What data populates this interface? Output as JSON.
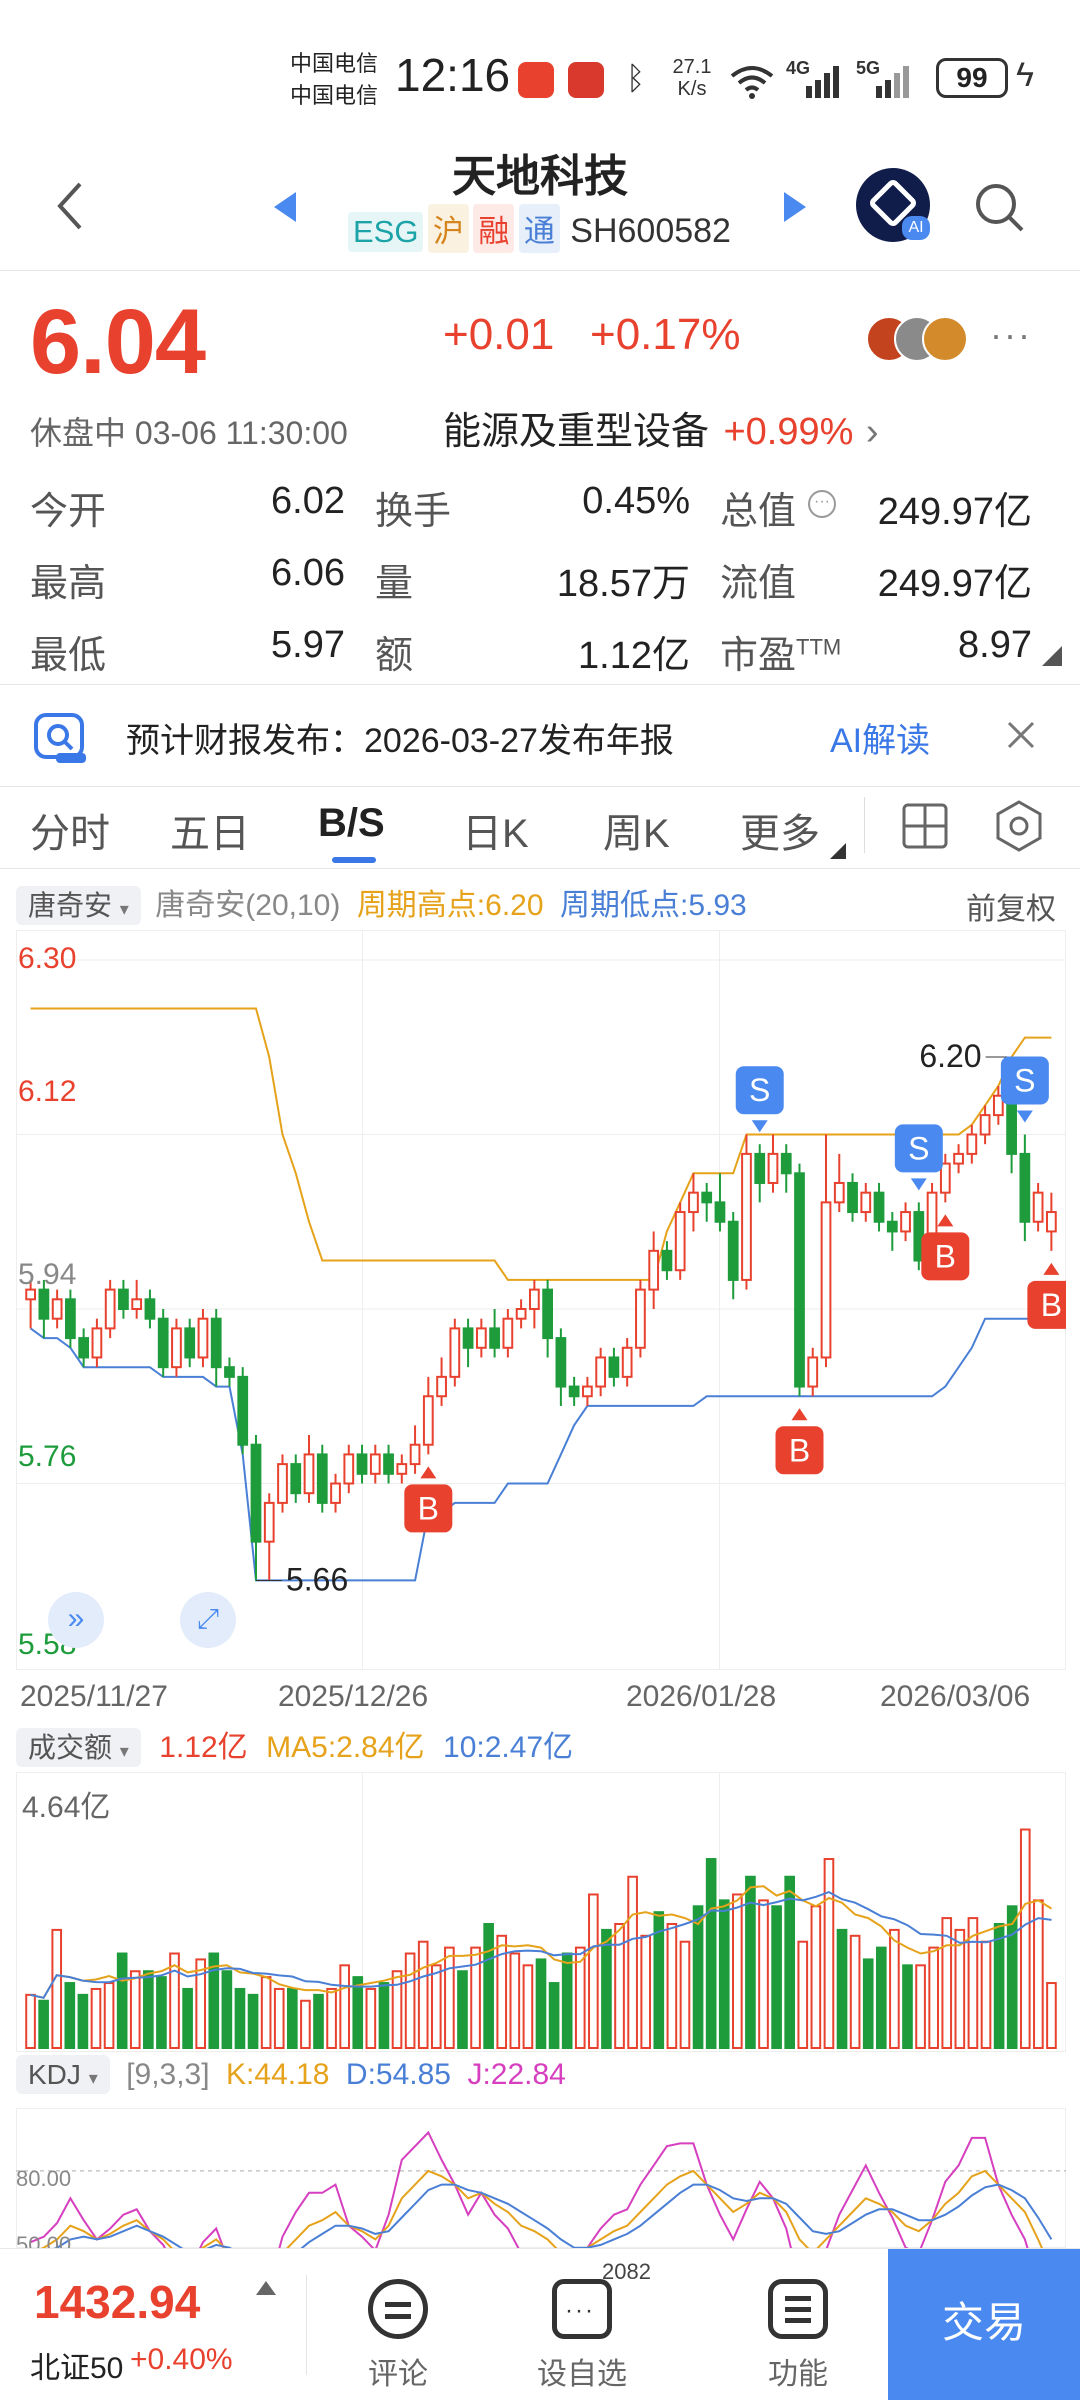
{
  "status_bar": {
    "carrier1": "中国电信",
    "carrier2": "中国电信",
    "time": "12:16",
    "net_speed_value": "27.1",
    "net_speed_unit": "K/s",
    "net1": "4G",
    "net2": "5G",
    "battery": "99"
  },
  "header": {
    "title": "天地科技",
    "tags": [
      "ESG",
      "沪",
      "融",
      "通"
    ],
    "code": "SH600582"
  },
  "quote": {
    "price": "6.04",
    "change": "+0.01",
    "change_pct": "+0.17%",
    "session_status": "休盘中 03-06 11:30:00",
    "sector": "能源及重型设备",
    "sector_change": "+0.99%"
  },
  "stats": {
    "open_label": "今开",
    "open": "6.02",
    "high_label": "最高",
    "high": "6.06",
    "low_label": "最低",
    "low": "5.97",
    "turnover_label": "换手",
    "turnover": "0.45%",
    "volume_label": "量",
    "volume": "18.57万",
    "amount_label": "额",
    "amount": "1.12亿",
    "mktcap_label": "总值",
    "mktcap": "249.97亿",
    "float_label": "流值",
    "float": "249.97亿",
    "pe_label": "市盈",
    "pe_sup": "TTM",
    "pe": "8.97"
  },
  "notice": {
    "text": "预计财报发布：2026-03-27发布年报",
    "ai_label": "AI解读"
  },
  "tabs": [
    "分时",
    "五日",
    "B/S",
    "日K",
    "周K",
    "更多"
  ],
  "active_tab": "B/S",
  "chart_header": {
    "indicator": "唐奇安",
    "params": "唐奇安(20,10)",
    "period_high": "周期高点:6.20",
    "period_low": "周期低点:5.93",
    "adjust": "前复权"
  },
  "price_axis": [
    "6.30",
    "6.12",
    "5.94",
    "5.76",
    "5.58"
  ],
  "date_axis": [
    "2025/11/27",
    "2025/12/26",
    "2026/01/28",
    "2026/03/06"
  ],
  "annotations": {
    "max_label": "6.20",
    "min_label": "5.66",
    "buy": "B",
    "sell": "S"
  },
  "volume_header": {
    "indicator": "成交额",
    "current": "1.12亿",
    "ma5": "MA5:2.84亿",
    "ma10": "10:2.47亿",
    "max_label": "4.64亿"
  },
  "kdj_header": {
    "indicator": "KDJ",
    "params": "[9,3,3]",
    "k": "K:44.18",
    "d": "D:54.85",
    "j": "J:22.84",
    "level_80": "80.00",
    "level_50": "50.00"
  },
  "bottom": {
    "index_value": "1432.94",
    "index_name": "北证50",
    "index_change": "+0.40%",
    "comment": "评论",
    "watch": "设自选",
    "watch_count": "2082",
    "function": "功能",
    "trade": "交易"
  },
  "colors": {
    "up": "#e8412e",
    "down": "#1e9c3c",
    "upper_band": "#e5a21a",
    "lower_band": "#4a7fd6",
    "trade_button": "#4a8af0"
  },
  "chart_data": {
    "type": "candlestick",
    "title": "唐奇安(20,10)",
    "y_range": [
      5.58,
      6.3
    ],
    "x_ticks": [
      "2025/11/27",
      "2025/12/26",
      "2026/01/28",
      "2026/03/06"
    ],
    "candles": [
      [
        5.95,
        5.96,
        5.92,
        5.97
      ],
      [
        5.96,
        5.93,
        5.91,
        5.97
      ],
      [
        5.93,
        5.95,
        5.92,
        5.96
      ],
      [
        5.95,
        5.91,
        5.9,
        5.96
      ],
      [
        5.91,
        5.89,
        5.88,
        5.92
      ],
      [
        5.89,
        5.92,
        5.88,
        5.93
      ],
      [
        5.92,
        5.96,
        5.91,
        5.97
      ],
      [
        5.96,
        5.94,
        5.93,
        5.97
      ],
      [
        5.94,
        5.95,
        5.93,
        5.97
      ],
      [
        5.95,
        5.93,
        5.92,
        5.96
      ],
      [
        5.93,
        5.88,
        5.87,
        5.94
      ],
      [
        5.88,
        5.92,
        5.87,
        5.93
      ],
      [
        5.92,
        5.89,
        5.88,
        5.93
      ],
      [
        5.89,
        5.93,
        5.88,
        5.94
      ],
      [
        5.93,
        5.88,
        5.86,
        5.94
      ],
      [
        5.88,
        5.87,
        5.86,
        5.89
      ],
      [
        5.87,
        5.8,
        5.79,
        5.88
      ],
      [
        5.8,
        5.7,
        5.66,
        5.81
      ],
      [
        5.7,
        5.74,
        5.66,
        5.75
      ],
      [
        5.74,
        5.78,
        5.73,
        5.79
      ],
      [
        5.78,
        5.75,
        5.74,
        5.79
      ],
      [
        5.75,
        5.79,
        5.74,
        5.81
      ],
      [
        5.79,
        5.74,
        5.73,
        5.8
      ],
      [
        5.74,
        5.76,
        5.73,
        5.77
      ],
      [
        5.76,
        5.79,
        5.75,
        5.8
      ],
      [
        5.79,
        5.77,
        5.76,
        5.8
      ],
      [
        5.77,
        5.79,
        5.76,
        5.8
      ],
      [
        5.79,
        5.77,
        5.76,
        5.8
      ],
      [
        5.77,
        5.78,
        5.76,
        5.79
      ],
      [
        5.78,
        5.8,
        5.77,
        5.82
      ],
      [
        5.8,
        5.85,
        5.79,
        5.87
      ],
      [
        5.85,
        5.87,
        5.84,
        5.89
      ],
      [
        5.87,
        5.92,
        5.86,
        5.93
      ],
      [
        5.92,
        5.9,
        5.88,
        5.93
      ],
      [
        5.9,
        5.92,
        5.89,
        5.93
      ],
      [
        5.92,
        5.9,
        5.89,
        5.94
      ],
      [
        5.9,
        5.93,
        5.89,
        5.94
      ],
      [
        5.93,
        5.94,
        5.92,
        5.95
      ],
      [
        5.94,
        5.96,
        5.92,
        5.97
      ],
      [
        5.96,
        5.91,
        5.89,
        5.97
      ],
      [
        5.91,
        5.86,
        5.84,
        5.92
      ],
      [
        5.86,
        5.85,
        5.84,
        5.87
      ],
      [
        5.85,
        5.86,
        5.84,
        5.87
      ],
      [
        5.86,
        5.89,
        5.85,
        5.9
      ],
      [
        5.89,
        5.87,
        5.86,
        5.9
      ],
      [
        5.87,
        5.9,
        5.86,
        5.91
      ],
      [
        5.9,
        5.96,
        5.89,
        5.97
      ],
      [
        5.96,
        6.0,
        5.94,
        6.02
      ],
      [
        6.0,
        5.98,
        5.97,
        6.01
      ],
      [
        5.98,
        6.04,
        5.97,
        6.05
      ],
      [
        6.04,
        6.06,
        6.02,
        6.08
      ],
      [
        6.06,
        6.05,
        6.03,
        6.07
      ],
      [
        6.05,
        6.03,
        6.02,
        6.08
      ],
      [
        6.03,
        5.97,
        5.95,
        6.04
      ],
      [
        5.97,
        6.1,
        5.96,
        6.12
      ],
      [
        6.1,
        6.07,
        6.05,
        6.11
      ],
      [
        6.07,
        6.1,
        6.06,
        6.12
      ],
      [
        6.1,
        6.08,
        6.06,
        6.11
      ],
      [
        6.08,
        5.86,
        5.85,
        6.09
      ],
      [
        5.86,
        5.89,
        5.85,
        5.9
      ],
      [
        5.89,
        6.05,
        5.88,
        6.12
      ],
      [
        6.05,
        6.07,
        6.04,
        6.1
      ],
      [
        6.07,
        6.04,
        6.03,
        6.08
      ],
      [
        6.04,
        6.06,
        6.03,
        6.07
      ],
      [
        6.06,
        6.03,
        6.02,
        6.07
      ],
      [
        6.03,
        6.02,
        6.0,
        6.04
      ],
      [
        6.02,
        6.04,
        6.01,
        6.05
      ],
      [
        6.04,
        5.99,
        5.98,
        6.05
      ],
      [
        5.99,
        6.06,
        5.98,
        6.07
      ],
      [
        6.06,
        6.09,
        6.05,
        6.1
      ],
      [
        6.09,
        6.1,
        6.08,
        6.11
      ],
      [
        6.1,
        6.12,
        6.09,
        6.13
      ],
      [
        6.12,
        6.14,
        6.11,
        6.15
      ],
      [
        6.14,
        6.16,
        6.13,
        6.17
      ],
      [
        6.16,
        6.1,
        6.08,
        6.2
      ],
      [
        6.1,
        6.03,
        6.01,
        6.12
      ],
      [
        6.03,
        6.06,
        6.02,
        6.07
      ],
      [
        6.02,
        6.04,
        6.0,
        6.06
      ]
    ],
    "donchian_upper": [
      6.25,
      6.25,
      6.25,
      6.25,
      6.25,
      6.25,
      6.25,
      6.25,
      6.25,
      6.25,
      6.25,
      6.25,
      6.25,
      6.25,
      6.25,
      6.25,
      6.25,
      6.25,
      6.2,
      6.12,
      6.08,
      6.03,
      5.99,
      5.99,
      5.99,
      5.99,
      5.99,
      5.99,
      5.99,
      5.99,
      5.99,
      5.99,
      5.99,
      5.99,
      5.99,
      5.99,
      5.97,
      5.97,
      5.97,
      5.97,
      5.97,
      5.97,
      5.97,
      5.97,
      5.97,
      5.97,
      5.97,
      5.97,
      6.02,
      6.05,
      6.08,
      6.08,
      6.08,
      6.08,
      6.12,
      6.12,
      6.12,
      6.12,
      6.12,
      6.12,
      6.12,
      6.12,
      6.12,
      6.12,
      6.12,
      6.12,
      6.12,
      6.12,
      6.12,
      6.12,
      6.12,
      6.13,
      6.15,
      6.17,
      6.2,
      6.22,
      6.22,
      6.22
    ],
    "donchian_lower": [
      5.92,
      5.91,
      5.91,
      5.9,
      5.88,
      5.88,
      5.88,
      5.88,
      5.88,
      5.88,
      5.87,
      5.87,
      5.87,
      5.87,
      5.86,
      5.86,
      5.79,
      5.66,
      5.66,
      5.66,
      5.66,
      5.66,
      5.66,
      5.66,
      5.66,
      5.66,
      5.66,
      5.66,
      5.66,
      5.66,
      5.73,
      5.73,
      5.74,
      5.74,
      5.74,
      5.74,
      5.76,
      5.76,
      5.76,
      5.76,
      5.79,
      5.82,
      5.84,
      5.84,
      5.84,
      5.84,
      5.84,
      5.84,
      5.84,
      5.84,
      5.84,
      5.85,
      5.85,
      5.85,
      5.85,
      5.85,
      5.85,
      5.85,
      5.85,
      5.85,
      5.85,
      5.85,
      5.85,
      5.85,
      5.85,
      5.85,
      5.85,
      5.85,
      5.85,
      5.86,
      5.88,
      5.9,
      5.93,
      5.93,
      5.93,
      5.93,
      5.93,
      5.93
    ],
    "buy_signal_indices": [
      30,
      58,
      69,
      77
    ],
    "sell_signal_indices": [
      55,
      67,
      75
    ],
    "volume_range": [
      0,
      4.64
    ],
    "volume": [
      0.9,
      0.8,
      2.0,
      1.1,
      0.9,
      1.0,
      1.1,
      1.6,
      1.3,
      1.3,
      1.2,
      1.6,
      1.0,
      1.5,
      1.6,
      1.3,
      1.0,
      0.9,
      1.2,
      1.0,
      1.0,
      0.8,
      0.9,
      1.0,
      1.4,
      1.2,
      1.0,
      1.1,
      1.3,
      1.6,
      1.8,
      1.4,
      1.7,
      1.3,
      1.7,
      2.1,
      1.9,
      1.6,
      1.4,
      1.5,
      1.1,
      1.6,
      1.7,
      2.6,
      2.0,
      2.1,
      2.9,
      1.9,
      2.3,
      2.1,
      1.8,
      2.4,
      3.2,
      2.5,
      2.6,
      2.9,
      2.5,
      2.4,
      2.9,
      1.8,
      2.4,
      3.2,
      2.0,
      1.9,
      1.5,
      1.7,
      2.0,
      1.4,
      1.4,
      1.7,
      2.2,
      2.0,
      2.2,
      1.8,
      2.1,
      2.4,
      3.7,
      2.5,
      1.1
    ],
    "kdj_K": [
      50,
      52,
      55,
      60,
      58,
      55,
      57,
      60,
      62,
      58,
      55,
      50,
      48,
      52,
      55,
      50,
      45,
      40,
      42,
      50,
      55,
      60,
      62,
      65,
      60,
      58,
      55,
      60,
      70,
      75,
      80,
      78,
      75,
      70,
      72,
      68,
      65,
      60,
      58,
      55,
      50,
      48,
      52,
      55,
      58,
      60,
      65,
      70,
      75,
      78,
      80,
      75,
      70,
      65,
      68,
      72,
      70,
      65,
      55,
      50,
      55,
      60,
      65,
      70,
      68,
      65,
      60,
      58,
      62,
      68,
      72,
      78,
      80,
      75,
      70,
      65,
      55,
      44
    ],
    "kdj_D": [
      48,
      50,
      52,
      55,
      56,
      55,
      56,
      58,
      60,
      58,
      56,
      53,
      50,
      51,
      53,
      52,
      49,
      45,
      44,
      47,
      50,
      54,
      57,
      60,
      60,
      59,
      57,
      58,
      63,
      68,
      73,
      75,
      75,
      73,
      72,
      70,
      68,
      65,
      62,
      59,
      55,
      52,
      52,
      53,
      55,
      57,
      60,
      64,
      68,
      72,
      75,
      75,
      73,
      70,
      69,
      70,
      70,
      68,
      63,
      58,
      57,
      58,
      61,
      64,
      66,
      66,
      64,
      62,
      62,
      64,
      67,
      71,
      74,
      75,
      73,
      70,
      63,
      55
    ],
    "kdj_J": [
      54,
      56,
      61,
      70,
      62,
      55,
      59,
      64,
      66,
      58,
      53,
      44,
      44,
      54,
      59,
      46,
      37,
      30,
      38,
      56,
      65,
      72,
      72,
      75,
      60,
      56,
      51,
      64,
      84,
      89,
      94,
      84,
      75,
      64,
      72,
      64,
      59,
      50,
      50,
      47,
      40,
      40,
      52,
      59,
      64,
      66,
      75,
      82,
      89,
      90,
      90,
      75,
      64,
      55,
      66,
      76,
      70,
      59,
      39,
      34,
      51,
      64,
      73,
      82,
      72,
      63,
      52,
      50,
      62,
      76,
      82,
      92,
      92,
      75,
      64,
      55,
      39,
      23
    ]
  }
}
